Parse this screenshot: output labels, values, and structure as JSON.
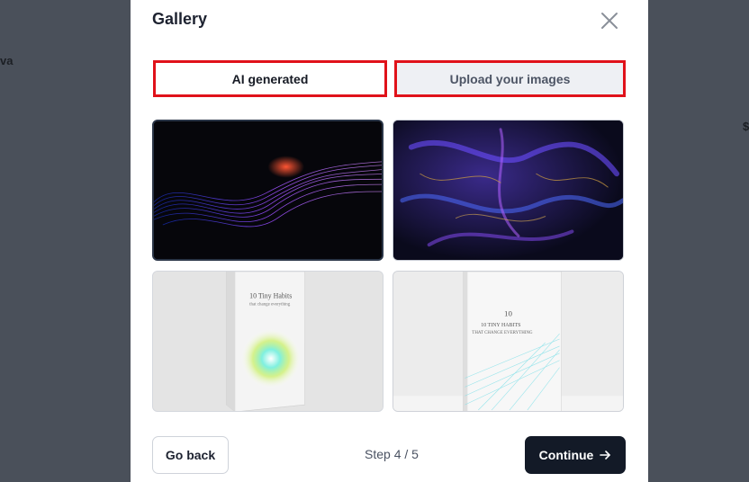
{
  "background": {
    "left_text": "va",
    "right_text": "$"
  },
  "modal": {
    "title": "Gallery",
    "close_icon": "close-icon",
    "tabs": [
      {
        "label": "AI generated",
        "active": true
      },
      {
        "label": "Upload your images",
        "active": false
      }
    ],
    "images": [
      {
        "name": "purple-wave-abstract"
      },
      {
        "name": "cosmic-marble-abstract"
      },
      {
        "name": "book-cover-radiant-burst",
        "cover_title": "10 Tiny Habits",
        "cover_subtitle": "that change everything"
      },
      {
        "name": "book-cover-light-grid",
        "cover_number": "10",
        "cover_title": "10 TINY HABITS",
        "cover_subtitle": "THAT CHANGE EVERYTHING"
      }
    ],
    "footer": {
      "back_label": "Go back",
      "step_text": "Step 4 / 5",
      "continue_label": "Continue"
    }
  },
  "colors": {
    "overlay": "#4a505a",
    "highlight_border": "#e0121a",
    "primary_button": "#131a27",
    "tab_inactive_bg": "#eef0f4"
  }
}
